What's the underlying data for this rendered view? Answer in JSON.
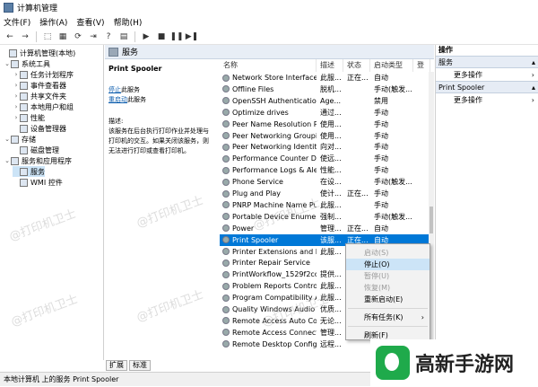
{
  "window": {
    "title": "计算机管理"
  },
  "menu": [
    "文件(F)",
    "操作(A)",
    "查看(V)",
    "帮助(H)"
  ],
  "toolbar": {
    "back": "←",
    "forward": "→",
    "up": "⬚",
    "show": "▦",
    "refresh": "⟳",
    "export": "⇥",
    "help": "?",
    "properties": "▤",
    "play": "▶",
    "stop": "■",
    "pause": "❚❚",
    "restart": "▶❚"
  },
  "tree": {
    "items": [
      {
        "label": "计算机管理(本地)",
        "expander": ""
      },
      {
        "label": "系统工具",
        "expander": "⌄"
      },
      {
        "label": "任务计划程序",
        "expander": "›"
      },
      {
        "label": "事件查看器",
        "expander": "›"
      },
      {
        "label": "共享文件夹",
        "expander": "›"
      },
      {
        "label": "本地用户和组",
        "expander": "›"
      },
      {
        "label": "性能",
        "expander": "›"
      },
      {
        "label": "设备管理器",
        "expander": ""
      },
      {
        "label": "存储",
        "expander": "⌄"
      },
      {
        "label": "磁盘管理",
        "expander": ""
      },
      {
        "label": "服务和应用程序",
        "expander": "⌄"
      },
      {
        "label": "服务",
        "expander": ""
      },
      {
        "label": "WMI 控件",
        "expander": ""
      }
    ]
  },
  "center": {
    "header": "服务",
    "service_name": "Print Spooler",
    "link_stop": "停止",
    "link_stop_suffix": "此服务",
    "link_restart": "重启动",
    "link_restart_suffix": "此服务",
    "desc_label": "描述:",
    "desc_text": "该服务在后台执行打印作业并处理与打印机的交互。如果关闭该服务，则无法进行打印或查看打印机。"
  },
  "list": {
    "columns": [
      "名称",
      "描述",
      "状态",
      "启动类型",
      "登"
    ],
    "rows": [
      {
        "name": "Network Store Interface ...",
        "desc": "此服...",
        "status": "正在...",
        "startup": "自动"
      },
      {
        "name": "Offline Files",
        "desc": "脱机...",
        "status": "",
        "startup": "手动(触发..."
      },
      {
        "name": "OpenSSH Authentication ...",
        "desc": "Age...",
        "status": "",
        "startup": "禁用"
      },
      {
        "name": "Optimize drives",
        "desc": "通过...",
        "status": "",
        "startup": "手动"
      },
      {
        "name": "Peer Name Resolution Pr...",
        "desc": "使用...",
        "status": "",
        "startup": "手动"
      },
      {
        "name": "Peer Networking Groupi...",
        "desc": "使用...",
        "status": "",
        "startup": "手动"
      },
      {
        "name": "Peer Networking Identity...",
        "desc": "向对...",
        "status": "",
        "startup": "手动"
      },
      {
        "name": "Performance Counter DL...",
        "desc": "使远...",
        "status": "",
        "startup": "手动"
      },
      {
        "name": "Performance Logs & Aler...",
        "desc": "性能...",
        "status": "",
        "startup": "手动"
      },
      {
        "name": "Phone Service",
        "desc": "在设...",
        "status": "",
        "startup": "手动(触发..."
      },
      {
        "name": "Plug and Play",
        "desc": "使计...",
        "status": "正在...",
        "startup": "手动"
      },
      {
        "name": "PNRP Machine Name Pu...",
        "desc": "此服...",
        "status": "",
        "startup": "手动"
      },
      {
        "name": "Portable Device Enumera...",
        "desc": "强制...",
        "status": "",
        "startup": "手动(触发..."
      },
      {
        "name": "Power",
        "desc": "管理...",
        "status": "正在...",
        "startup": "自动"
      },
      {
        "name": "Print Spooler",
        "desc": "该服...",
        "status": "正在...",
        "startup": "自动"
      },
      {
        "name": "Printer Extensions and N...",
        "desc": "此服...",
        "status": "",
        "startup": ""
      },
      {
        "name": "Printer Repair Service",
        "desc": "",
        "status": "",
        "startup": ""
      },
      {
        "name": "PrintWorkflow_1529f2cc",
        "desc": "提供...",
        "status": "",
        "startup": ""
      },
      {
        "name": "Problem Reports Control...",
        "desc": "此服...",
        "status": "",
        "startup": ""
      },
      {
        "name": "Program Compatibility A...",
        "desc": "此服...",
        "status": "",
        "startup": ""
      },
      {
        "name": "Quality Windows Audio V...",
        "desc": "优质...",
        "status": "",
        "startup": ""
      },
      {
        "name": "Remote Access Auto Con...",
        "desc": "无论...",
        "status": "",
        "startup": ""
      },
      {
        "name": "Remote Access Connecti...",
        "desc": "管理...",
        "status": "",
        "startup": ""
      },
      {
        "name": "Remote Desktop Configu...",
        "desc": "远程...",
        "status": "",
        "startup": ""
      }
    ]
  },
  "tabs": [
    "扩展",
    "标准"
  ],
  "actions": {
    "header": "操作",
    "sections": [
      {
        "title": "服务",
        "item": "更多操作"
      },
      {
        "title": "Print Spooler",
        "item": "更多操作"
      }
    ]
  },
  "context_menu": {
    "items": [
      {
        "label": "启动(S)",
        "disabled": true
      },
      {
        "label": "停止(O)",
        "disabled": false
      },
      {
        "label": "暂停(U)",
        "disabled": true
      },
      {
        "label": "恢复(M)",
        "disabled": true
      },
      {
        "label": "重新启动(E)",
        "disabled": false
      },
      {
        "label": "所有任务(K)",
        "disabled": false,
        "arrow": "›"
      },
      {
        "label": "刷新(F)",
        "disabled": false
      }
    ]
  },
  "statusbar": "本地计算机 上的服务 Print Spooler",
  "watermarks": [
    "@打印机卫士",
    "@打印机卫士",
    "@打印机卫士",
    "@打印机卫士",
    "@打印机卫士",
    "@打印机卫士"
  ],
  "brand": {
    "text": "高新手游网"
  }
}
